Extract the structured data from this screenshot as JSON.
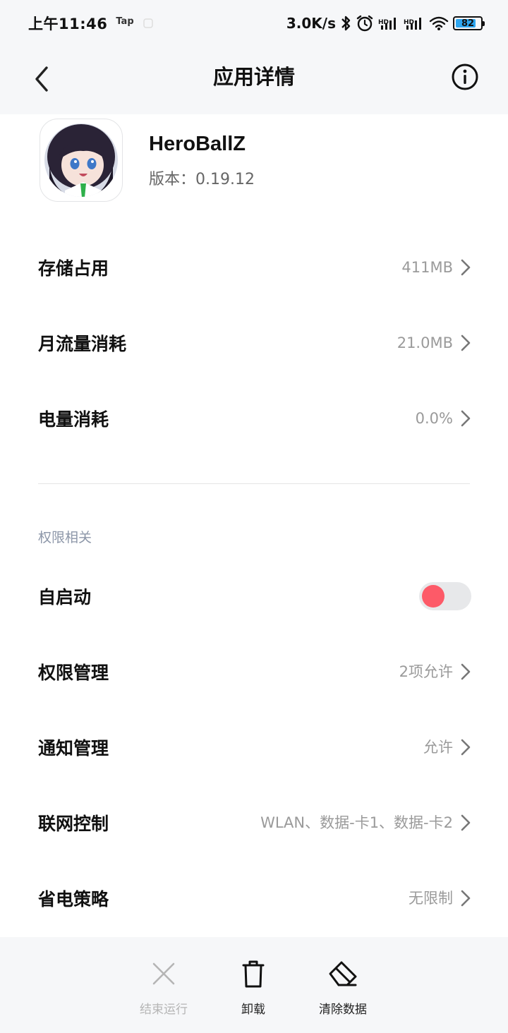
{
  "status_bar": {
    "time": "上午11:46",
    "tap": "Tap",
    "speed": "3.0K/s",
    "battery": "82",
    "battery_level": 0.82
  },
  "header": {
    "title": "应用详情"
  },
  "app": {
    "name": "HeroBallZ",
    "version": "版本：0.19.12"
  },
  "rows": [
    {
      "label": "存储占用",
      "value": "411MB"
    },
    {
      "label": "月流量消耗",
      "value": "21.0MB"
    },
    {
      "label": "电量消耗",
      "value": "0.0%"
    }
  ],
  "permissions": {
    "section_title": "权限相关",
    "autostart_label": "自启动",
    "autostart_enabled": false,
    "items": [
      {
        "label": "权限管理",
        "value": "2项允许"
      },
      {
        "label": "通知管理",
        "value": "允许"
      },
      {
        "label": "联网控制",
        "value": "WLAN、数据-卡1、数据-卡2"
      },
      {
        "label": "省电策略",
        "value": "无限制"
      }
    ]
  },
  "bottom_bar": {
    "stop": "结束运行",
    "uninstall": "卸载",
    "clear_data": "清除数据"
  },
  "colors": {
    "accent_toggle": "#fd5a68",
    "value_gray": "#9a9a9a",
    "section_title": "#8c96a8",
    "header_bg": "#f6f7f9"
  }
}
